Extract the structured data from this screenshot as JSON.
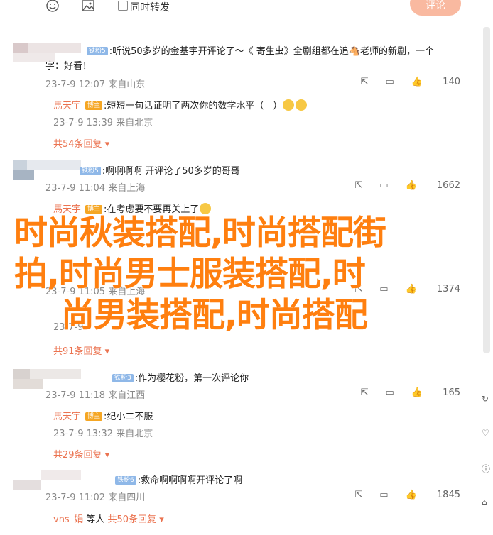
{
  "toolbar": {
    "checkbox_label": "同时转发",
    "comment_button": "评论"
  },
  "comments": [
    {
      "user_suffix": ":听说50多岁的金基宇开评论了～《 寄生虫》全剧组都在追🐴老师的新剧，一个",
      "line2": "字：好看！",
      "level": "铁粉5",
      "date": "23-7-9 12:07",
      "location": "来自山东",
      "likes": "140",
      "reply": {
        "name": "馬天宇",
        "badge": "博主",
        "text": ":短短一句话证明了两次你的数学水平（　）",
        "date": "23-7-9 13:39",
        "location": "来自北京"
      },
      "more": "共54条回复"
    },
    {
      "user_suffix": ":啊啊啊啊 开评论了50多岁的哥哥",
      "level": "铁粉5",
      "date": "23-7-9 11:04",
      "location": "来自上海",
      "likes": "1662",
      "reply": {
        "name": "馬天宇",
        "badge": "博主",
        "text": ":在考虑要不要再关上了"
      }
    },
    {
      "date_partial": "23-7-9 11:05",
      "location": "来自上海",
      "likes": "1374",
      "reply_date": "23-7-9 ",
      "more": "共91条回复"
    },
    {
      "user_suffix": ":作为樱花粉，第一次评论你",
      "level": "铁粉3",
      "date": "23-7-9 11:18",
      "location": "来自江西",
      "likes": "165",
      "reply": {
        "name": "馬天宇",
        "badge": "博主",
        "text": ":纪小二不服",
        "date": "23-7-9 13:32",
        "location": "来自北京"
      },
      "more": "共29条回复"
    },
    {
      "user_suffix": ":救命啊啊啊啊开评论了啊",
      "level": "铁粉6",
      "date": "23-7-9 11:02",
      "location": "来自四川",
      "likes": "1845",
      "reply": {
        "name": "vns_娟",
        "badge": "等人",
        "more": "共50条回复"
      }
    }
  ],
  "overlay": {
    "line1": "时尚秋装搭配,时尚搭配街",
    "line2": "拍,时尚男士服装搭配,时",
    "line3": "尚男装搭配,时尚搭配"
  },
  "colors": {
    "accent": "#eb7350",
    "overlay": "#ff7f0f"
  }
}
